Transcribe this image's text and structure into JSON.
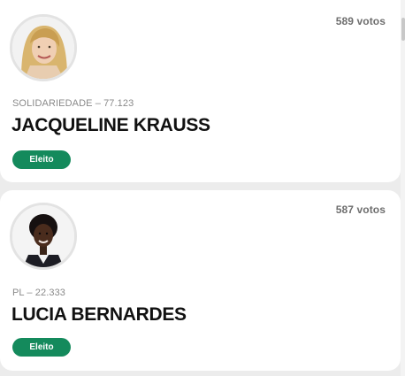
{
  "candidates": [
    {
      "votes": "589 votos",
      "party": "SOLIDARIEDADE – 77.123",
      "name": "JACQUELINE KRAUSS",
      "status": "Eleito",
      "photo": "portrait-blonde-woman"
    },
    {
      "votes": "587 votos",
      "party": "PL – 22.333",
      "name": "LUCIA BERNARDES",
      "status": "Eleito",
      "photo": "portrait-dark-haired-woman"
    }
  ],
  "colors": {
    "badge": "#148a5c",
    "card": "#ffffff",
    "background": "#ececec"
  }
}
